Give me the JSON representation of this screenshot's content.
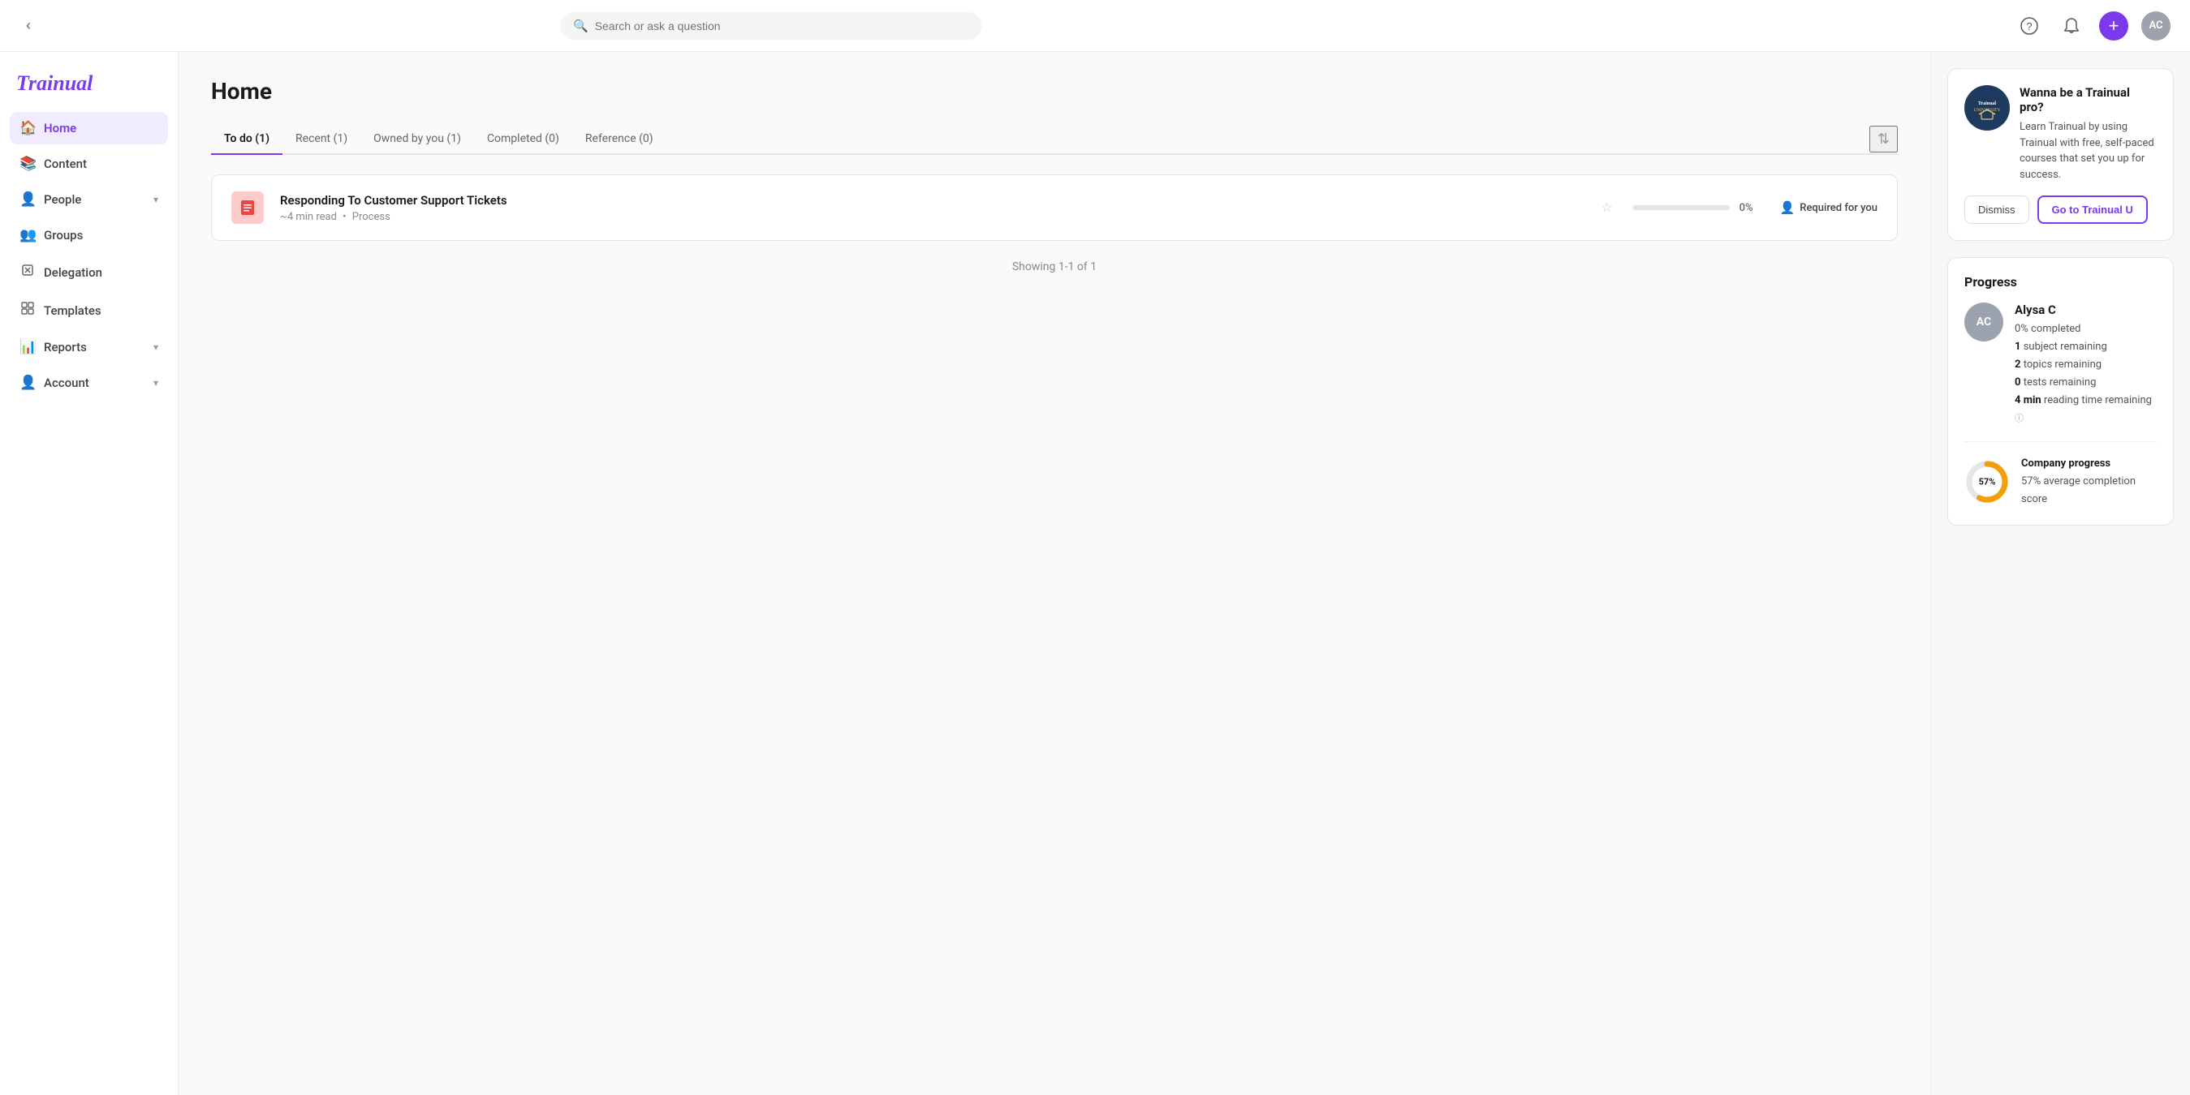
{
  "app": {
    "name": "Trainual",
    "logo_text": "Trainual"
  },
  "topbar": {
    "search_placeholder": "Search or ask a question",
    "user_initials": "AC",
    "collapse_icon": "‹",
    "help_icon": "?",
    "bell_icon": "🔔",
    "add_icon": "+"
  },
  "sidebar": {
    "items": [
      {
        "id": "home",
        "label": "Home",
        "icon": "🏠",
        "active": true
      },
      {
        "id": "content",
        "label": "Content",
        "icon": "📚",
        "active": false
      },
      {
        "id": "people",
        "label": "People",
        "icon": "👤",
        "active": false,
        "has_chevron": true
      },
      {
        "id": "groups",
        "label": "Groups",
        "icon": "👥",
        "active": false
      },
      {
        "id": "delegation",
        "label": "Delegation",
        "icon": "◇",
        "active": false
      },
      {
        "id": "templates",
        "label": "Templates",
        "icon": "⧉",
        "active": false
      },
      {
        "id": "reports",
        "label": "Reports",
        "icon": "📊",
        "active": false,
        "has_chevron": true
      },
      {
        "id": "account",
        "label": "Account",
        "icon": "👤",
        "active": false,
        "has_chevron": true
      }
    ]
  },
  "main": {
    "page_title": "Home",
    "tabs": [
      {
        "id": "todo",
        "label": "To do (1)",
        "active": true
      },
      {
        "id": "recent",
        "label": "Recent (1)",
        "active": false
      },
      {
        "id": "owned",
        "label": "Owned by you (1)",
        "active": false
      },
      {
        "id": "completed",
        "label": "Completed (0)",
        "active": false
      },
      {
        "id": "reference",
        "label": "Reference (0)",
        "active": false
      }
    ],
    "content_items": [
      {
        "title": "Responding To Customer Support Tickets",
        "read_time": "~4 min read",
        "type": "Process",
        "progress": 0,
        "progress_label": "0%",
        "required_label": "Required for you",
        "thumb_bg": "#fecaca",
        "thumb_icon": "📋"
      }
    ],
    "showing_text": "Showing 1-1 of 1"
  },
  "right_panel": {
    "promo": {
      "title": "Wanna be a Trainual pro?",
      "description": "Learn Trainual by using Trainual with free, self-paced courses that set you up for success.",
      "dismiss_label": "Dismiss",
      "goto_label": "Go to Trainual U"
    },
    "progress_section": {
      "title": "Progress",
      "user": {
        "name": "Alysa C",
        "initials": "AC",
        "completed_pct": "0%",
        "subjects_remaining": "1",
        "topics_remaining": "2",
        "tests_remaining": "0",
        "reading_time": "4 min"
      },
      "company": {
        "title": "Company progress",
        "pct": "57%",
        "pct_number": 57,
        "description": "average completion score"
      }
    }
  }
}
